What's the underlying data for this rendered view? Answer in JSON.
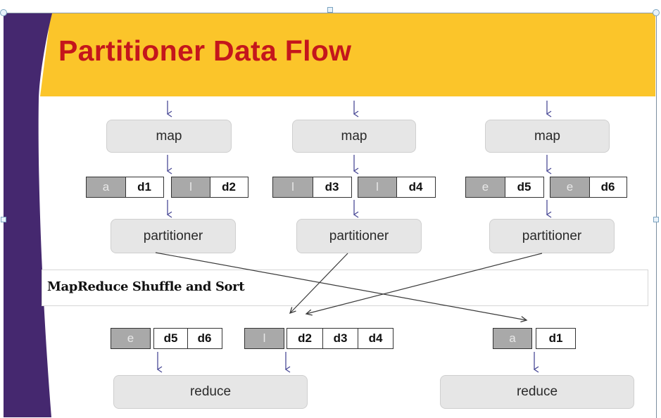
{
  "title": "Partitioner Data Flow",
  "colors": {
    "title": "#c4161c",
    "header_band": "#fbc52a",
    "side_band": "#45286f",
    "flow_arrow": "#4a4a96",
    "shuffle_arrow": "#3a3a3a",
    "process_box": "#e6e6e6",
    "key_cell": "#a9a9a9"
  },
  "mappers": [
    {
      "label": "map",
      "outputs": [
        {
          "key": "a",
          "values": [
            "d1"
          ]
        },
        {
          "key": "l",
          "values": [
            "d2"
          ]
        }
      ],
      "partitioner_label": "partitioner"
    },
    {
      "label": "map",
      "outputs": [
        {
          "key": "l",
          "values": [
            "d3"
          ]
        },
        {
          "key": "l",
          "values": [
            "d4"
          ]
        }
      ],
      "partitioner_label": "partitioner"
    },
    {
      "label": "map",
      "outputs": [
        {
          "key": "e",
          "values": [
            "d5"
          ]
        },
        {
          "key": "e",
          "values": [
            "d6"
          ]
        }
      ],
      "partitioner_label": "partitioner"
    }
  ],
  "shuffle": {
    "label": "MapReduce Shuffle and Sort"
  },
  "reducer_inputs": [
    {
      "key": "e",
      "values": [
        "d5",
        "d6"
      ]
    },
    {
      "key": "l",
      "values": [
        "d2",
        "d3",
        "d4"
      ]
    },
    {
      "key": "a",
      "values": [
        "d1"
      ]
    }
  ],
  "reducers": [
    {
      "label": "reduce"
    },
    {
      "label": "reduce"
    }
  ]
}
